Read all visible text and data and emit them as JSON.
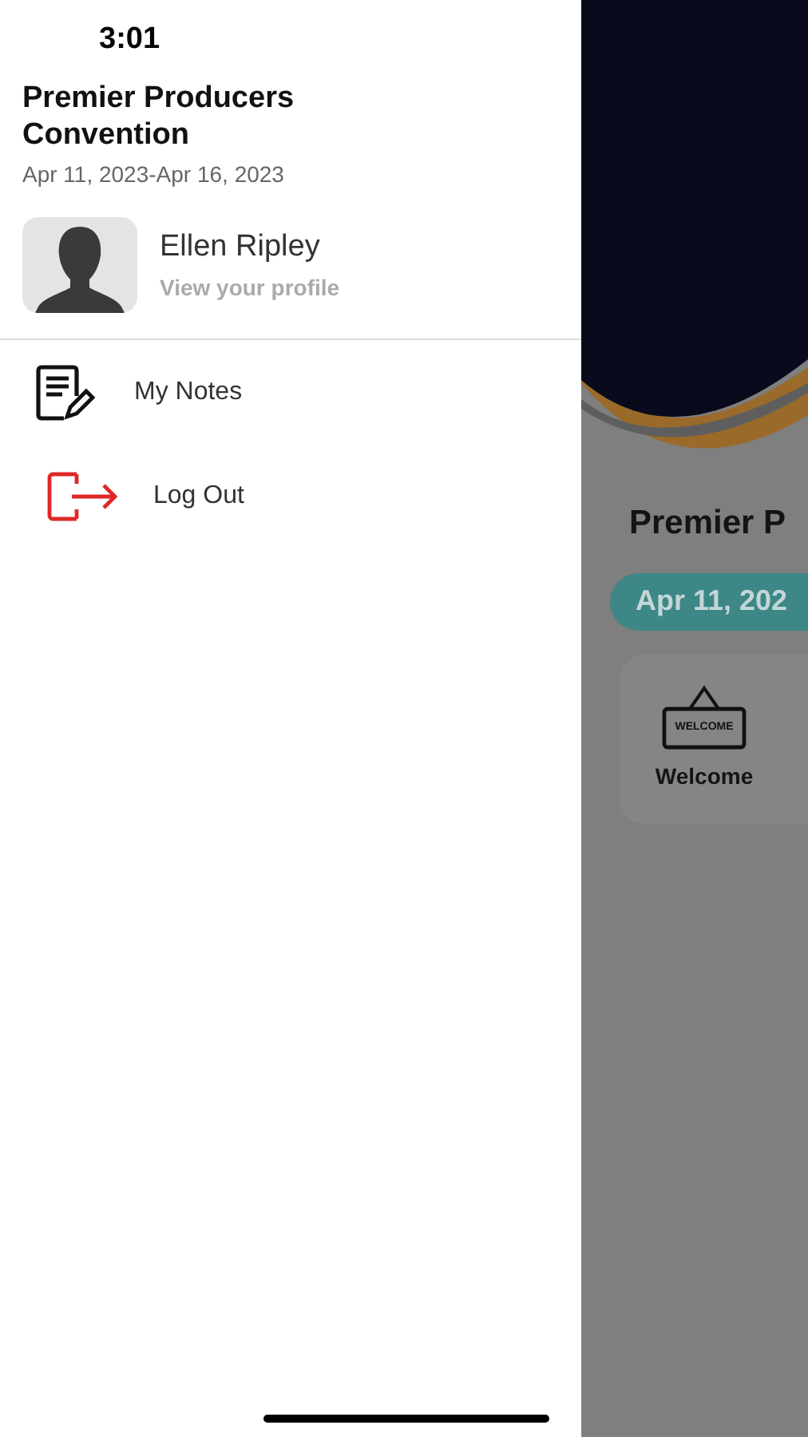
{
  "status_bar": {
    "time": "3:01"
  },
  "drawer": {
    "event_title": "Premier Producers Convention",
    "event_dates": "Apr 11, 2023-Apr 16, 2023",
    "profile": {
      "name": "Ellen Ripley",
      "subtitle": "View your profile"
    },
    "items": [
      {
        "kind": "notes",
        "label": "My Notes"
      },
      {
        "kind": "logout",
        "label": "Log Out"
      }
    ]
  },
  "background": {
    "title": "Premier P",
    "date_badge": "Apr 11, 202",
    "tiles": [
      {
        "sign_text": "WELCOME",
        "label": "Welcome"
      }
    ]
  }
}
